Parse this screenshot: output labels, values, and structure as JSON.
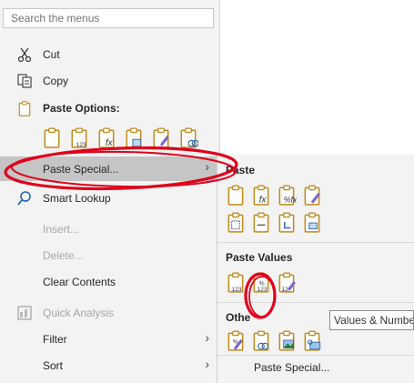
{
  "context_menu": {
    "search_placeholder": "Search the menus",
    "items": [
      {
        "label": "Cut",
        "icon": "scissors-icon"
      },
      {
        "label": "Copy",
        "icon": "copy-icon"
      },
      {
        "label": "Paste Options:",
        "icon": "clipboard-icon"
      },
      {
        "label": "Paste Special...",
        "has_submenu": true
      },
      {
        "label": "Smart Lookup",
        "icon": "search-icon"
      },
      {
        "label": "Insert...",
        "disabled": true
      },
      {
        "label": "Delete...",
        "disabled": true
      },
      {
        "label": "Clear Contents"
      },
      {
        "label": "Quick Analysis",
        "icon": "quick-analysis-icon",
        "disabled": true
      },
      {
        "label": "Filter",
        "has_submenu": true
      },
      {
        "label": "Sort",
        "has_submenu": true
      }
    ],
    "paste_option_icons": [
      "paste-icon",
      "paste-values-icon",
      "paste-formulas-icon",
      "paste-transpose-icon",
      "paste-formatting-icon",
      "paste-link-icon"
    ]
  },
  "submenu": {
    "paste_title": "Paste",
    "paste_values_title": "Paste Values",
    "other_title": "Othe",
    "paste_special_link": "Paste Special..."
  },
  "tooltip": {
    "text": "Values & Number Formatting (A"
  },
  "colors": {
    "menu_bg": "#f3f3f3",
    "highlight_bg": "#c5c5c5",
    "accent_gold": "#c08b1d",
    "annotation_red": "#e0001b"
  }
}
